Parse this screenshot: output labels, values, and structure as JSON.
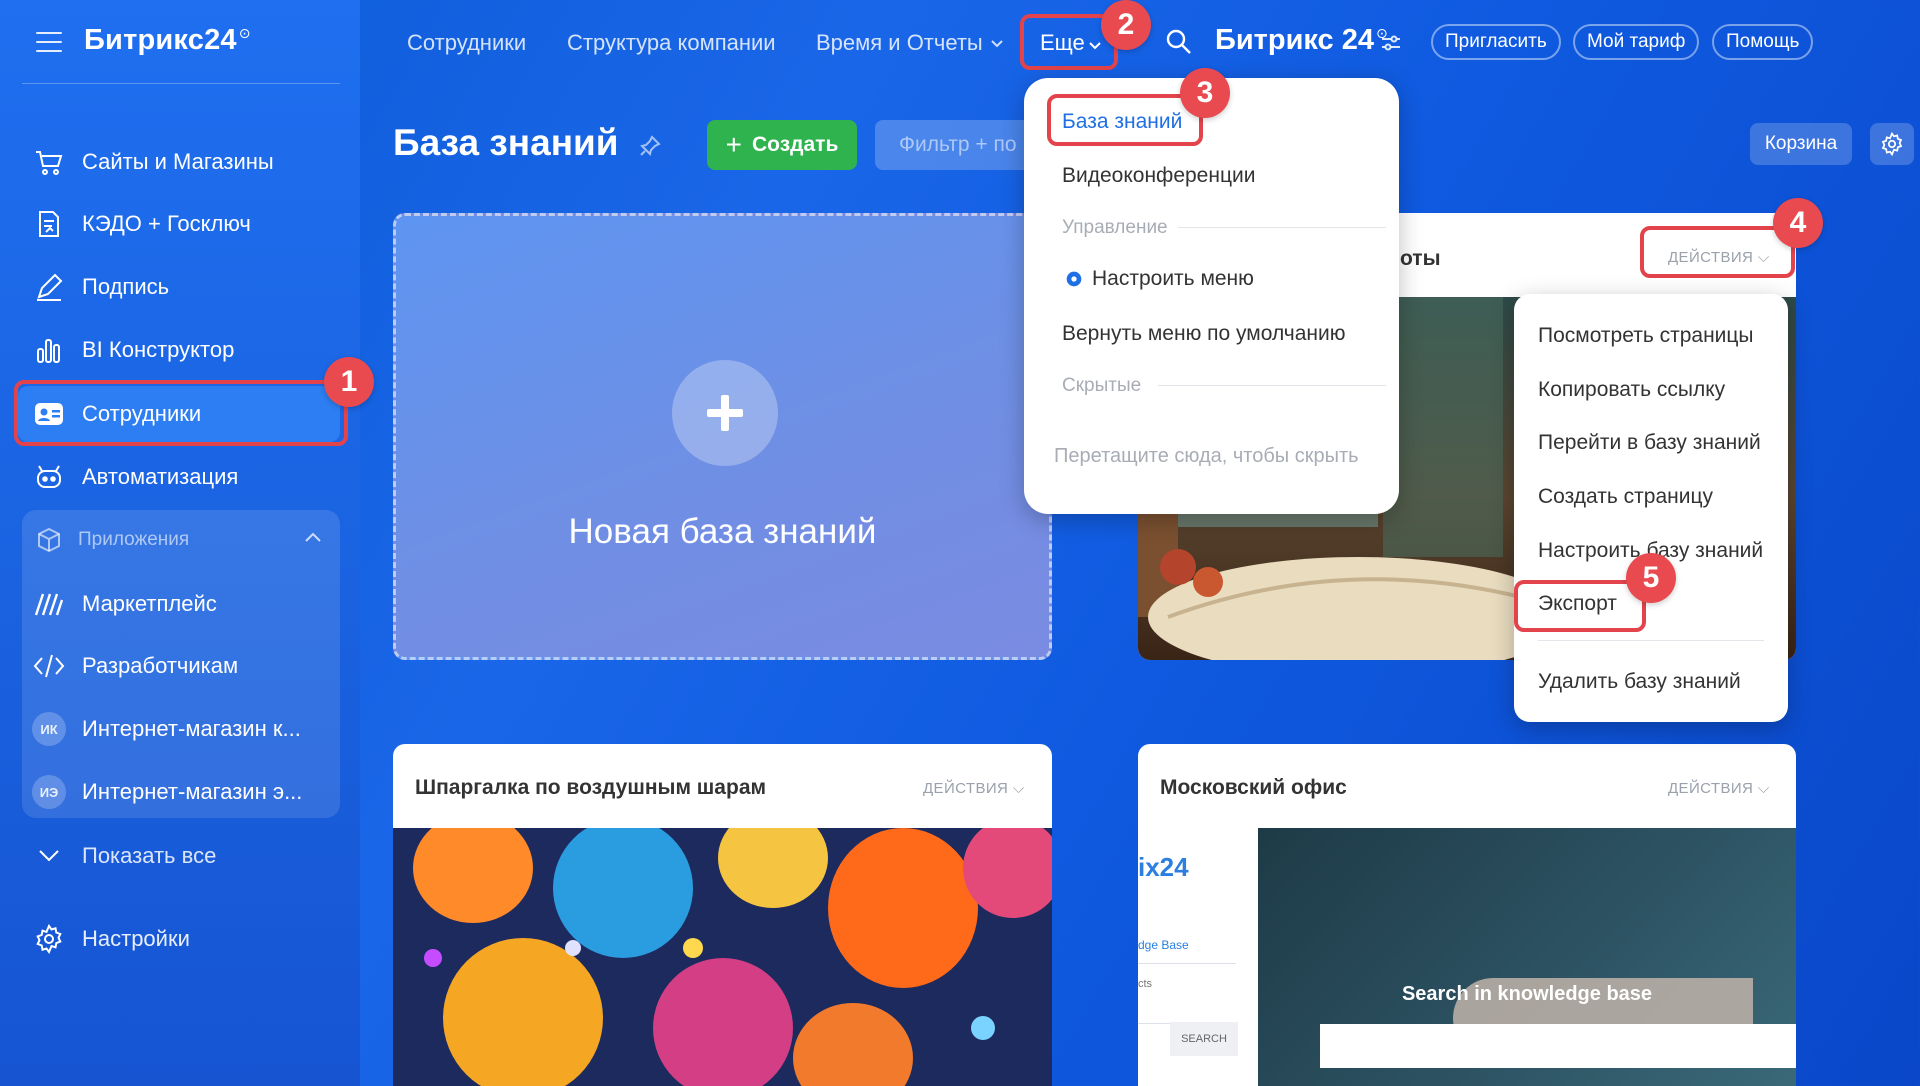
{
  "sidebar": {
    "brand": "Битрикс24",
    "items": [
      {
        "label": "Сайты и Магазины"
      },
      {
        "label": "КЭДО + Госключ"
      },
      {
        "label": "Подпись"
      },
      {
        "label": "BI Конструктор"
      },
      {
        "label": "Сотрудники"
      },
      {
        "label": "Автоматизация"
      }
    ],
    "apps_header": "Приложения",
    "apps": [
      {
        "label": "Маркетплейс"
      },
      {
        "label": "Разработчикам"
      },
      {
        "label": "Интернет-магазин к...",
        "avatar": "ИК"
      },
      {
        "label": "Интернет-магазин э...",
        "avatar": "ИЭ"
      }
    ],
    "show_all": "Показать все",
    "settings": "Настройки"
  },
  "topbar": {
    "links": [
      "Сотрудники",
      "Структура компании",
      "Время и Отчеты"
    ],
    "more": "Еще",
    "brand": "Битрикс 24",
    "buttons": [
      "Пригласить",
      "Мой тариф",
      "Помощь"
    ]
  },
  "page": {
    "title": "База знаний",
    "create": "Создать",
    "filter_placeholder": "Фильтр + по",
    "trash": "Корзина"
  },
  "cards": {
    "new_kb": "Новая база знаний",
    "actions_label": "ДЕЙСТВИЯ",
    "card1_title_partial": "оты",
    "card2_title": "Шпаргалка по воздушным шарам",
    "card3_title": "Московский офис",
    "card3_preview": {
      "logo_partial": "ix24",
      "link_partial": "dge Base",
      "item_partial": "cts",
      "search_button": "SEARCH",
      "search_heading": "Search in knowledge base"
    }
  },
  "more_menu": {
    "items": [
      "База знаний",
      "Видеоконференции"
    ],
    "section_manage": "Управление",
    "configure": "Настроить меню",
    "reset": "Вернуть меню по умолчанию",
    "section_hidden": "Скрытые",
    "drag_hint": "Перетащите сюда, чтобы скрыть"
  },
  "actions_menu": {
    "items": [
      "Посмотреть страницы",
      "Копировать ссылку",
      "Перейти в базу знаний",
      "Создать страницу",
      "Настроить базу знаний",
      "Экспорт"
    ],
    "delete": "Удалить базу знаний"
  },
  "callouts": [
    "1",
    "2",
    "3",
    "4",
    "5"
  ],
  "colors": {
    "accent_green": "#2fb34e",
    "callout_red": "#e3434b",
    "link_blue": "#1f6fe5"
  }
}
